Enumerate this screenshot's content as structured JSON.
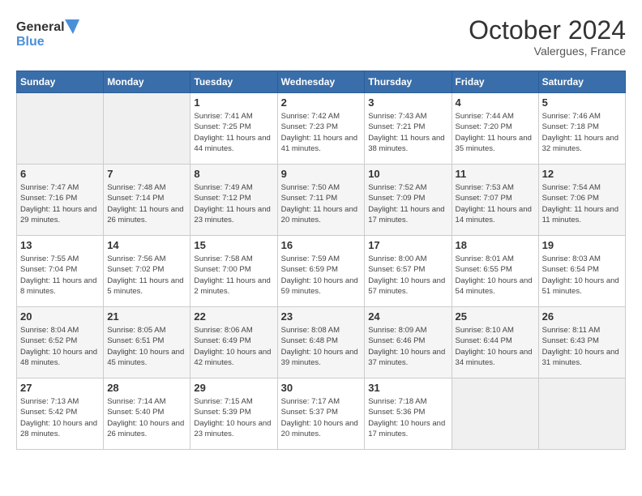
{
  "header": {
    "logo_line1": "General",
    "logo_line2": "Blue",
    "month": "October 2024",
    "location": "Valergues, France"
  },
  "weekdays": [
    "Sunday",
    "Monday",
    "Tuesday",
    "Wednesday",
    "Thursday",
    "Friday",
    "Saturday"
  ],
  "weeks": [
    [
      {
        "day": "",
        "info": ""
      },
      {
        "day": "",
        "info": ""
      },
      {
        "day": "1",
        "info": "Sunrise: 7:41 AM\nSunset: 7:25 PM\nDaylight: 11 hours and 44 minutes."
      },
      {
        "day": "2",
        "info": "Sunrise: 7:42 AM\nSunset: 7:23 PM\nDaylight: 11 hours and 41 minutes."
      },
      {
        "day": "3",
        "info": "Sunrise: 7:43 AM\nSunset: 7:21 PM\nDaylight: 11 hours and 38 minutes."
      },
      {
        "day": "4",
        "info": "Sunrise: 7:44 AM\nSunset: 7:20 PM\nDaylight: 11 hours and 35 minutes."
      },
      {
        "day": "5",
        "info": "Sunrise: 7:46 AM\nSunset: 7:18 PM\nDaylight: 11 hours and 32 minutes."
      }
    ],
    [
      {
        "day": "6",
        "info": "Sunrise: 7:47 AM\nSunset: 7:16 PM\nDaylight: 11 hours and 29 minutes."
      },
      {
        "day": "7",
        "info": "Sunrise: 7:48 AM\nSunset: 7:14 PM\nDaylight: 11 hours and 26 minutes."
      },
      {
        "day": "8",
        "info": "Sunrise: 7:49 AM\nSunset: 7:12 PM\nDaylight: 11 hours and 23 minutes."
      },
      {
        "day": "9",
        "info": "Sunrise: 7:50 AM\nSunset: 7:11 PM\nDaylight: 11 hours and 20 minutes."
      },
      {
        "day": "10",
        "info": "Sunrise: 7:52 AM\nSunset: 7:09 PM\nDaylight: 11 hours and 17 minutes."
      },
      {
        "day": "11",
        "info": "Sunrise: 7:53 AM\nSunset: 7:07 PM\nDaylight: 11 hours and 14 minutes."
      },
      {
        "day": "12",
        "info": "Sunrise: 7:54 AM\nSunset: 7:06 PM\nDaylight: 11 hours and 11 minutes."
      }
    ],
    [
      {
        "day": "13",
        "info": "Sunrise: 7:55 AM\nSunset: 7:04 PM\nDaylight: 11 hours and 8 minutes."
      },
      {
        "day": "14",
        "info": "Sunrise: 7:56 AM\nSunset: 7:02 PM\nDaylight: 11 hours and 5 minutes."
      },
      {
        "day": "15",
        "info": "Sunrise: 7:58 AM\nSunset: 7:00 PM\nDaylight: 11 hours and 2 minutes."
      },
      {
        "day": "16",
        "info": "Sunrise: 7:59 AM\nSunset: 6:59 PM\nDaylight: 10 hours and 59 minutes."
      },
      {
        "day": "17",
        "info": "Sunrise: 8:00 AM\nSunset: 6:57 PM\nDaylight: 10 hours and 57 minutes."
      },
      {
        "day": "18",
        "info": "Sunrise: 8:01 AM\nSunset: 6:55 PM\nDaylight: 10 hours and 54 minutes."
      },
      {
        "day": "19",
        "info": "Sunrise: 8:03 AM\nSunset: 6:54 PM\nDaylight: 10 hours and 51 minutes."
      }
    ],
    [
      {
        "day": "20",
        "info": "Sunrise: 8:04 AM\nSunset: 6:52 PM\nDaylight: 10 hours and 48 minutes."
      },
      {
        "day": "21",
        "info": "Sunrise: 8:05 AM\nSunset: 6:51 PM\nDaylight: 10 hours and 45 minutes."
      },
      {
        "day": "22",
        "info": "Sunrise: 8:06 AM\nSunset: 6:49 PM\nDaylight: 10 hours and 42 minutes."
      },
      {
        "day": "23",
        "info": "Sunrise: 8:08 AM\nSunset: 6:48 PM\nDaylight: 10 hours and 39 minutes."
      },
      {
        "day": "24",
        "info": "Sunrise: 8:09 AM\nSunset: 6:46 PM\nDaylight: 10 hours and 37 minutes."
      },
      {
        "day": "25",
        "info": "Sunrise: 8:10 AM\nSunset: 6:44 PM\nDaylight: 10 hours and 34 minutes."
      },
      {
        "day": "26",
        "info": "Sunrise: 8:11 AM\nSunset: 6:43 PM\nDaylight: 10 hours and 31 minutes."
      }
    ],
    [
      {
        "day": "27",
        "info": "Sunrise: 7:13 AM\nSunset: 5:42 PM\nDaylight: 10 hours and 28 minutes."
      },
      {
        "day": "28",
        "info": "Sunrise: 7:14 AM\nSunset: 5:40 PM\nDaylight: 10 hours and 26 minutes."
      },
      {
        "day": "29",
        "info": "Sunrise: 7:15 AM\nSunset: 5:39 PM\nDaylight: 10 hours and 23 minutes."
      },
      {
        "day": "30",
        "info": "Sunrise: 7:17 AM\nSunset: 5:37 PM\nDaylight: 10 hours and 20 minutes."
      },
      {
        "day": "31",
        "info": "Sunrise: 7:18 AM\nSunset: 5:36 PM\nDaylight: 10 hours and 17 minutes."
      },
      {
        "day": "",
        "info": ""
      },
      {
        "day": "",
        "info": ""
      }
    ]
  ]
}
